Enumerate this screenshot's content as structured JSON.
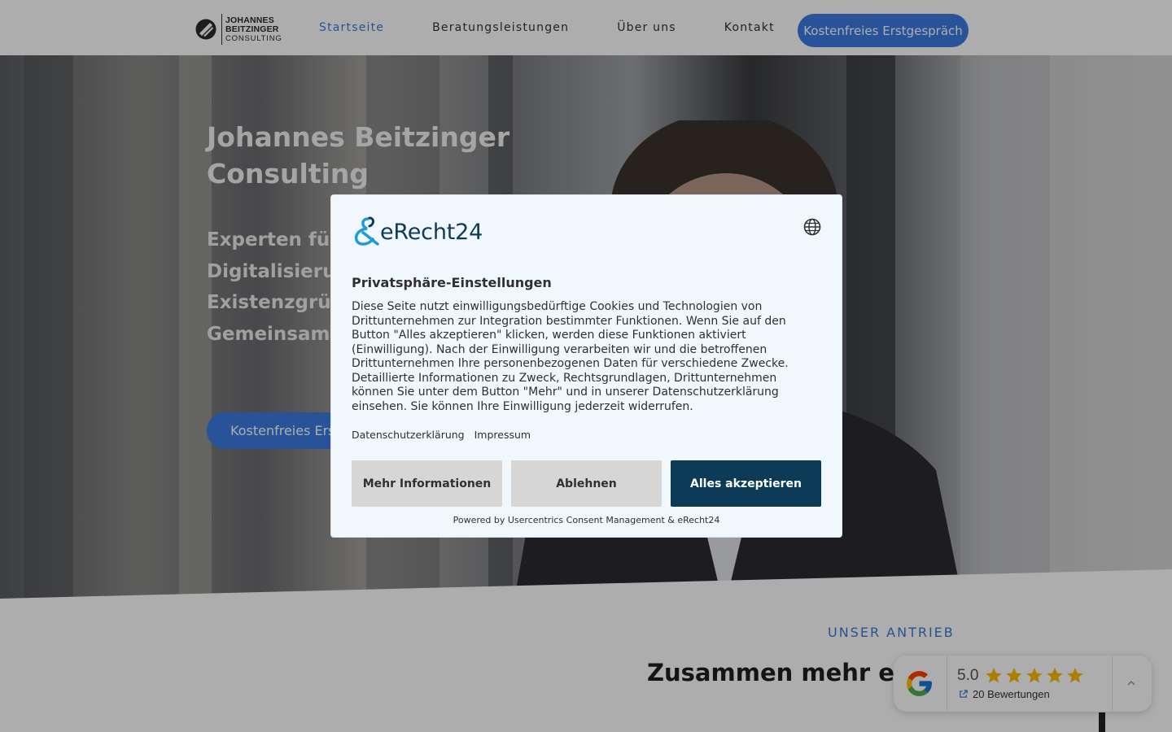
{
  "header": {
    "logo": {
      "line1": "JOHANNES",
      "line2": "BEITZINGER",
      "line3": "CONSULTING"
    },
    "nav": [
      {
        "label": "Startseite",
        "active": true
      },
      {
        "label": "Beratungsleistungen",
        "active": false
      },
      {
        "label": "Über uns",
        "active": false
      },
      {
        "label": "Kontakt",
        "active": false
      }
    ],
    "cta_label": "Kostenfreies Erstgespräch"
  },
  "hero": {
    "headline": "Johannes Beitzinger Consulting",
    "sub_lines": [
      "Experten für",
      "Digitalisierun",
      "Existenzgrün",
      "Gemeinsam g"
    ],
    "cta_label": "Kostenfreies Erstgespräch"
  },
  "section": {
    "kicker": "UNSER ANTRIEB",
    "title": "Zusammen mehr erre"
  },
  "google_badge": {
    "score": "5.0",
    "stars": 5,
    "reviews_label": "20 Bewertungen"
  },
  "consent": {
    "brand": "eRecht24",
    "title": "Privatsphäre-Einstellungen",
    "body": "Diese Seite nutzt einwilligungsbedürftige Cookies und Technologien von Drittunternehmen zur Integration bestimmter Funktionen. Wenn Sie auf den Button \"Alles akzeptieren\" klicken, werden diese Funktionen aktiviert (Einwilligung). Nach der Einwilligung verarbeiten wir und die betroffenen Drittunternehmen Ihre personenbezogenen Daten für verschiedene Zwecke. Detaillierte Informationen zu Zweck, Rechtsgrundlagen, Drittunternehmen können Sie unter dem Button \"Mehr\" und in unserer Datenschutzerklärung einsehen. Sie können Ihre Einwilligung jederzeit widerrufen.",
    "links": [
      "Datenschutzerklärung",
      "Impressum"
    ],
    "buttons": {
      "more": "Mehr Informationen",
      "reject": "Ablehnen",
      "accept": "Alles akzeptieren"
    },
    "powered_by": "Powered by Usercentrics Consent Management & eRecht24"
  },
  "colors": {
    "accent_blue": "#3b7be0",
    "consent_dark": "#0b3b57",
    "modal_bg": "#f0f7fd",
    "star": "#fbbc04"
  }
}
